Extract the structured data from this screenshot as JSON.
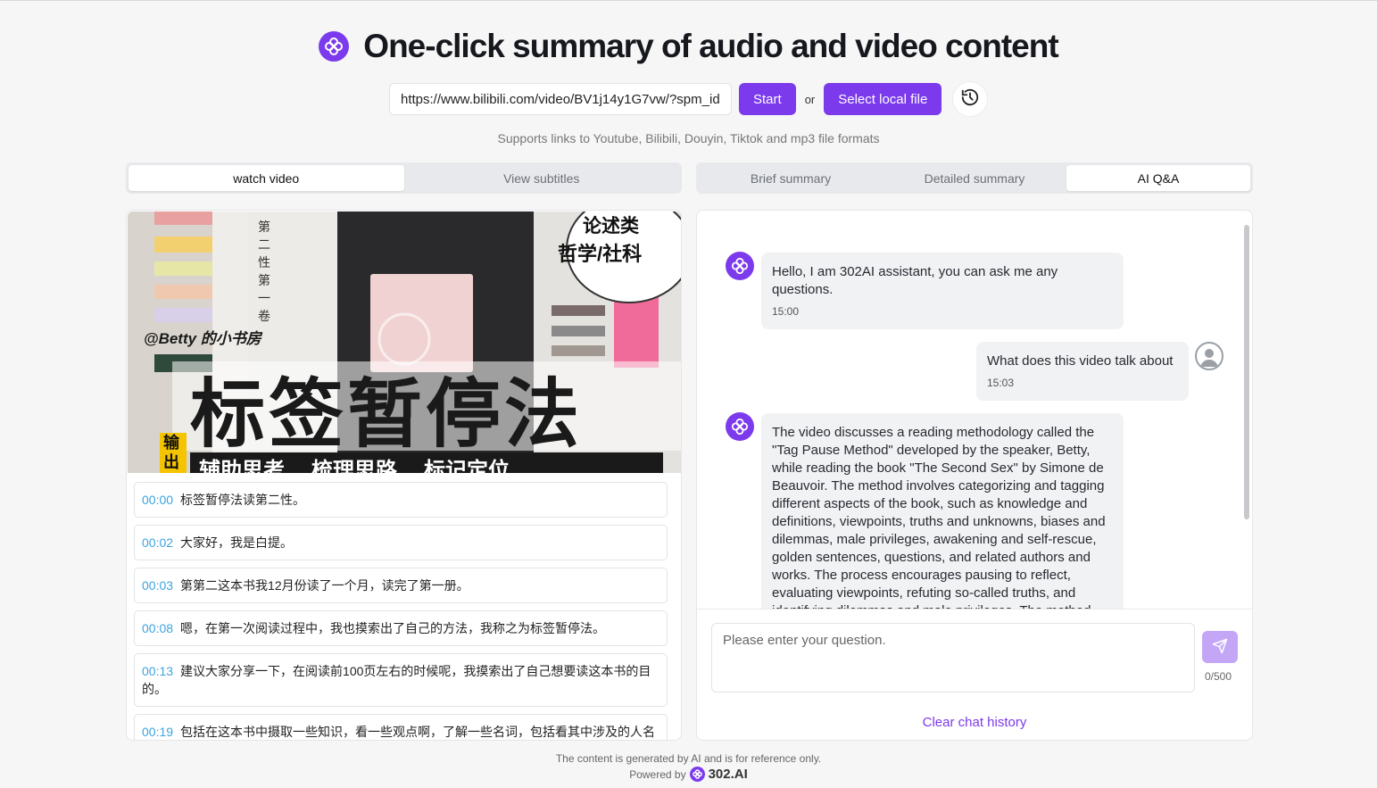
{
  "header": {
    "title": "One-click summary of audio and video content",
    "url_value": "https://www.bilibili.com/video/BV1j14y1G7vw/?spm_id",
    "start_label": "Start",
    "or_label": "or",
    "select_local_label": "Select local file",
    "support_text": "Supports links to Youtube, Bilibili, Douyin, Tiktok and mp3 file formats"
  },
  "left_tabs": [
    {
      "label": "watch video",
      "active": true
    },
    {
      "label": "View subtitles",
      "active": false
    }
  ],
  "right_tabs": [
    {
      "label": "Brief summary",
      "active": false
    },
    {
      "label": "Detailed summary",
      "active": false
    },
    {
      "label": "AI Q&A",
      "active": true
    }
  ],
  "video": {
    "watermark": "@Betty 的小书房",
    "big_title": "标签暂停法",
    "bubble_line1": "论述类",
    "bubble_line2": "哲学/社科",
    "output_tag": "输出",
    "bottom_tags": [
      "辅助思考",
      "梳理思路",
      "标记定位"
    ],
    "book_text": "第二性 第一卷"
  },
  "subtitles": [
    {
      "time": "00:00",
      "text": "标签暂停法读第二性。"
    },
    {
      "time": "00:02",
      "text": "大家好，我是白提。"
    },
    {
      "time": "00:03",
      "text": "第第二这本书我12月份读了一个月，读完了第一册。"
    },
    {
      "time": "00:08",
      "text": "嗯，在第一次阅读过程中，我也摸索出了自己的方法，我称之为标签暂停法。"
    },
    {
      "time": "00:13",
      "text": "建议大家分享一下，在阅读前100页左右的时候呢，我摸索出了自己想要读这本书的目的。"
    },
    {
      "time": "00:19",
      "text": "包括在这本书中摄取一些知识，看一些观点啊，了解一些名词，包括看其中涉及的人名和作品。"
    }
  ],
  "chat": {
    "messages": [
      {
        "role": "assistant",
        "text": "Hello, I am 302AI assistant, you can ask me any questions.",
        "time": "15:00"
      },
      {
        "role": "user",
        "text": "What does this video talk about",
        "time": "15:03"
      },
      {
        "role": "assistant",
        "text": "The video discusses a reading methodology called the \"Tag Pause Method\" developed by the speaker, Betty, while reading the book \"The Second Sex\" by Simone de Beauvoir. The method involves categorizing and tagging different aspects of the book, such as knowledge and definitions, viewpoints, truths and unknowns, biases and dilemmas, male privileges, awakening and self-rescue, golden sentences, questions, and related authors and works. The process encourages pausing to reflect, evaluating viewpoints, refuting so-called truths, and identifying dilemmas and male privileges. The method",
        "time": ""
      }
    ],
    "input_placeholder": "Please enter your question.",
    "counter": "0/500",
    "clear_label": "Clear chat history"
  },
  "footer": {
    "disclaimer": "The content is generated by AI and is for reference only.",
    "powered_by": "Powered by",
    "brand": "302.AI"
  },
  "colors": {
    "accent": "#7c3aed",
    "timestamp": "#3ba4e0",
    "send_disabled": "#c4a6f7"
  }
}
